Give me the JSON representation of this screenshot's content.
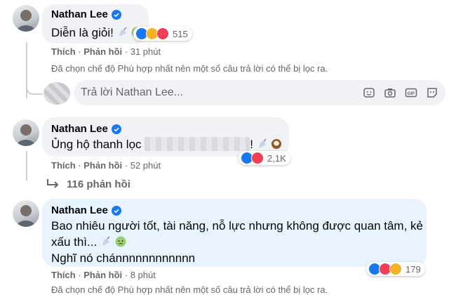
{
  "comments": [
    {
      "name": "Nathan Lee",
      "text": "Diễn là giỏi!",
      "reaction_count": "515",
      "like_label": "Thích",
      "reply_label": "Phản hồi",
      "time": "31 phút",
      "note": "Đã chọn chế độ Phù hợp nhất nên một số câu trả lời có thể bị lọc ra."
    },
    {
      "name": "Nathan Lee",
      "text_prefix": "Ủng hộ thanh lọc",
      "text_suffix": "!",
      "reaction_count": "2,1K",
      "like_label": "Thích",
      "reply_label": "Phản hồi",
      "time": "52 phút",
      "replies_link": "116 phản hồi"
    },
    {
      "name": "Nathan Lee",
      "text_line1": "Bao nhiêu người tốt, tài năng, nỗ lực nhưng không được quan tâm, kẻ",
      "text_line2": "xấu thì...",
      "text_line3": "Nghĩ nó chánnnnnnnnnnnn",
      "reaction_count": "179",
      "like_label": "Thích",
      "reply_label": "Phản hồi",
      "time": "8 phút",
      "note": "Đã chọn chế độ Phù hợp nhất nên một số câu trả lời có thể bị lọc ra."
    }
  ],
  "reply_box": {
    "placeholder": "Trả lời Nathan Lee...",
    "icons": [
      "sticker-icon",
      "camera-icon",
      "gif-icon",
      "emoji-sticker-icon"
    ]
  },
  "colors": {
    "bubble": "#f0f2f5",
    "bubble_highlight": "#e7f3ff",
    "verified": "#1877f2",
    "meta": "#65676b",
    "like": "#1877f2",
    "love": "#f33e58"
  }
}
